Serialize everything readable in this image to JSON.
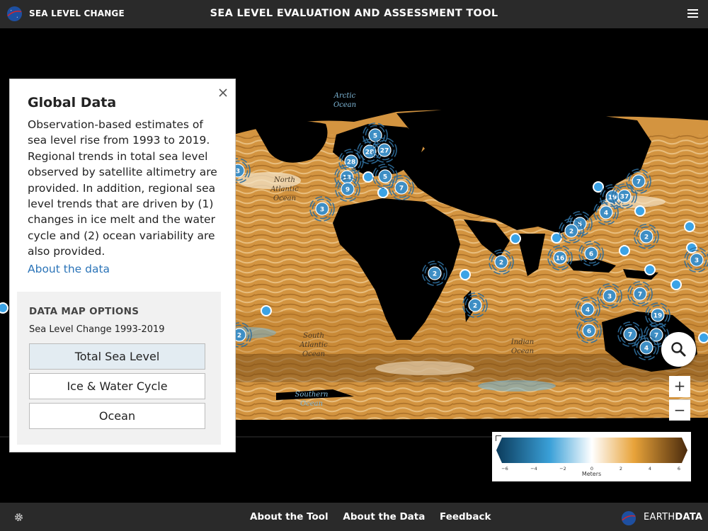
{
  "header": {
    "brand": "SEA LEVEL CHANGE",
    "title": "SEA LEVEL EVALUATION AND ASSESSMENT TOOL"
  },
  "map": {
    "ocean_labels": {
      "arctic_1": "Arctic",
      "arctic_2": "Ocean",
      "north_atlantic_1": "North",
      "north_atlantic_2": "Atlantic",
      "north_atlantic_3": "Ocean",
      "south_atlantic_1": "South",
      "south_atlantic_2": "Atlantic",
      "south_atlantic_3": "Ocean",
      "indian_1": "Indian",
      "indian_2": "Ocean",
      "southern_1": "Southern",
      "southern_2": "Ocean"
    },
    "clusters": [
      "5",
      "28",
      "27",
      "28",
      "13",
      "5",
      "9",
      "7",
      "3",
      "3",
      "7",
      "19",
      "37",
      "4",
      "5",
      "2",
      "2",
      "16",
      "6",
      "3",
      "2",
      "2",
      "2",
      "3",
      "7",
      "4",
      "19",
      "6",
      "7",
      "7",
      "4",
      "2"
    ]
  },
  "panel": {
    "title": "Global Data",
    "description": "Observation-based estimates of sea level rise from 1993 to 2019. Regional trends in total sea level observed by satellite altimetry are provided. In addition, regional sea level trends that are driven by (1) changes in ice melt and the water cycle and (2) ocean variability are also provided.",
    "link": "About the data",
    "options_title": "DATA MAP OPTIONS",
    "options_subtitle": "Sea Level Change 1993-2019",
    "buttons": [
      "Total Sea Level",
      "Ice & Water Cycle",
      "Ocean"
    ],
    "active_button": "Total Sea Level"
  },
  "controls": {
    "zoom_in": "+",
    "zoom_out": "−"
  },
  "legend": {
    "ticks": [
      "−6",
      "−4",
      "−2",
      "0",
      "2",
      "4",
      "6"
    ],
    "unit": "Meters",
    "colors": [
      "#0d3d5c",
      "#3aa0d8",
      "#ffffff",
      "#e8a33a",
      "#4a2a0c"
    ]
  },
  "footer": {
    "links": [
      "About the Tool",
      "About the Data",
      "Feedback"
    ],
    "earthdata_prefix": "EARTH",
    "earthdata_suffix": "DATA"
  },
  "icons": {
    "menu": "menu-icon",
    "close": "close-icon",
    "search": "search-icon",
    "settings": "gear-icon"
  }
}
